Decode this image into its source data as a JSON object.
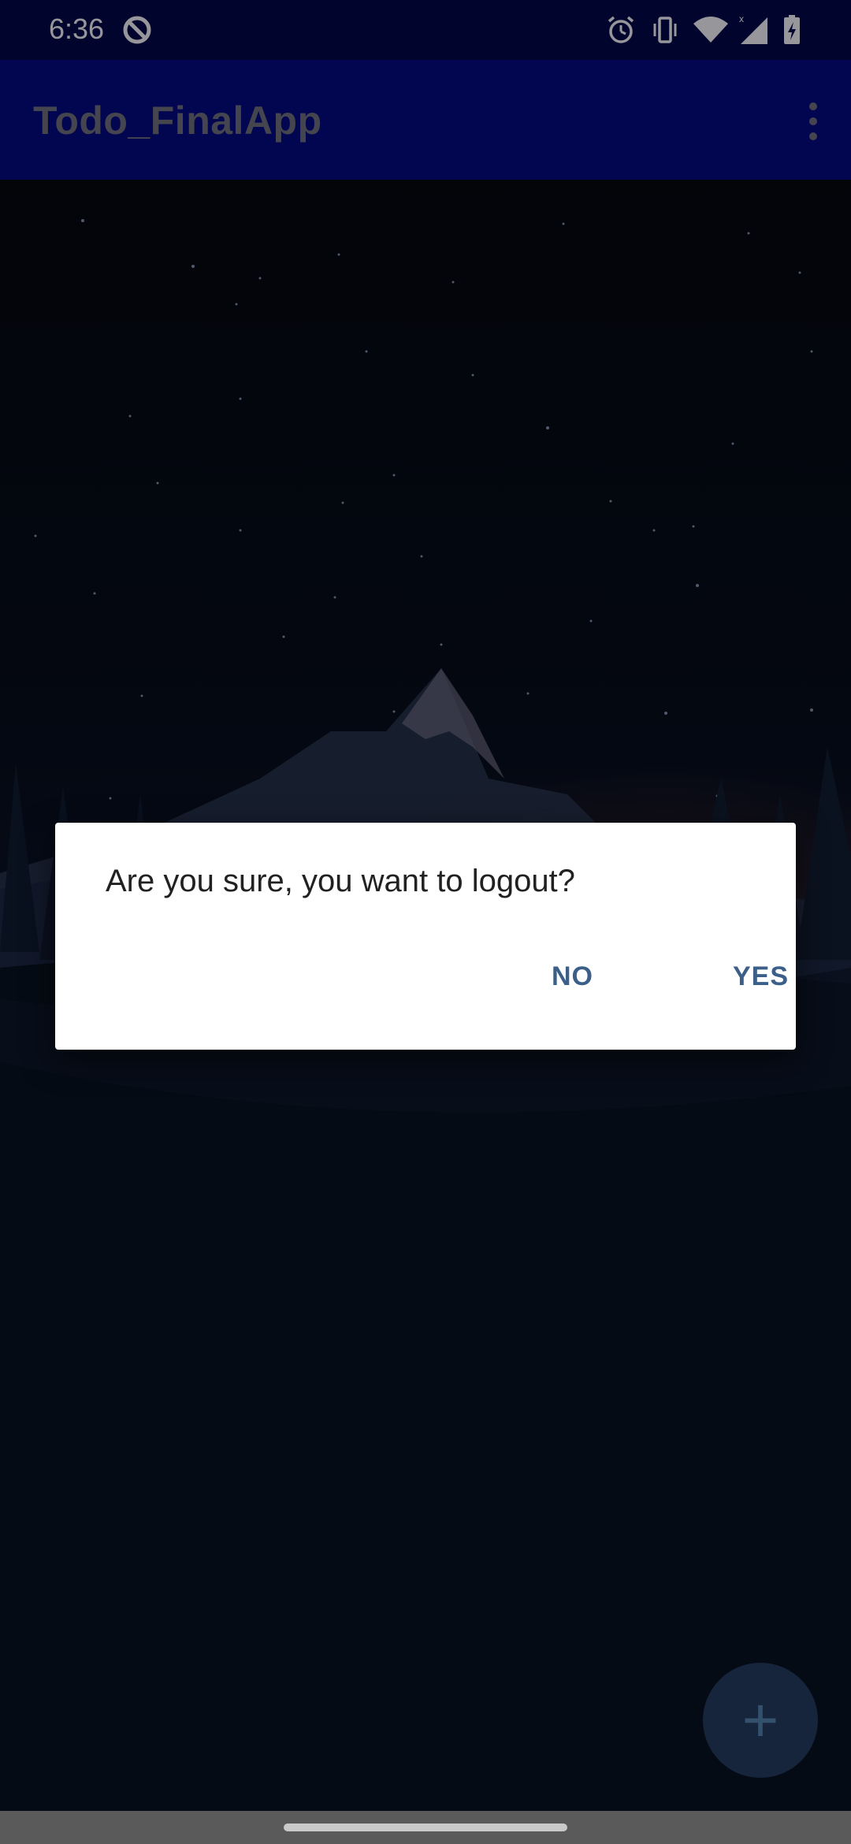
{
  "status_bar": {
    "time": "6:36",
    "icons": [
      "do-not-disturb-icon",
      "alarm-icon",
      "vibrate-icon",
      "wifi-icon",
      "signal-icon",
      "battery-charging-icon"
    ]
  },
  "app_bar": {
    "title": "Todo_FinalApp",
    "menu_icon": "more-vert-icon"
  },
  "dialog": {
    "message": "Are you sure, you want to logout?",
    "negative_label": "NO",
    "positive_label": "YES"
  },
  "fab": {
    "icon": "plus-icon",
    "label": "+"
  },
  "colors": {
    "status_bar": "#030845",
    "app_bar": "#04087a",
    "dialog_button": "#3c5f8a",
    "nav_bar": "#5a5a5a"
  }
}
